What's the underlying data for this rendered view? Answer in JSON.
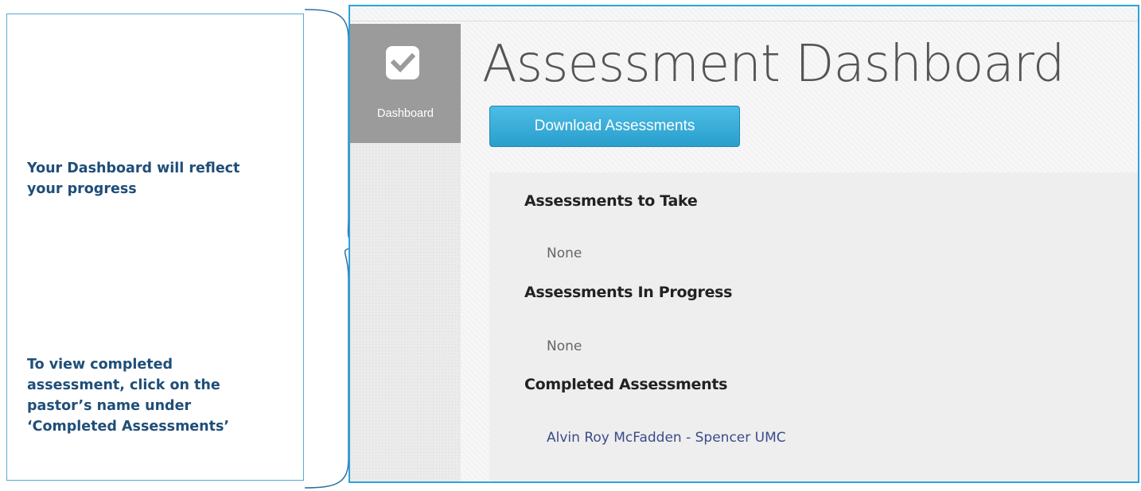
{
  "callout": {
    "note_progress": "Your Dashboard will reflect your progress",
    "note_completed": "To view completed assessment, click on the pastor’s name under ‘Completed Assessments’"
  },
  "sidebar": {
    "items": [
      {
        "label": "Dashboard",
        "icon": "checkbox-icon",
        "active": true
      }
    ]
  },
  "main": {
    "title": "Assessment Dashboard",
    "download_button": "Download Assessments",
    "sections": [
      {
        "heading": "Assessments to Take",
        "items": [
          "None"
        ]
      },
      {
        "heading": "Assessments In Progress",
        "items": [
          "None"
        ]
      },
      {
        "heading": "Completed Assessments",
        "items": [
          "Alvin Roy McFadden - Spencer UMC"
        ]
      }
    ]
  },
  "colors": {
    "callout_text": "#1f4e79",
    "frame_border": "#2aa3dc",
    "button": "#2a9fcc",
    "sidebar_active": "#9b9b9b",
    "link": "#3b4c8a"
  }
}
